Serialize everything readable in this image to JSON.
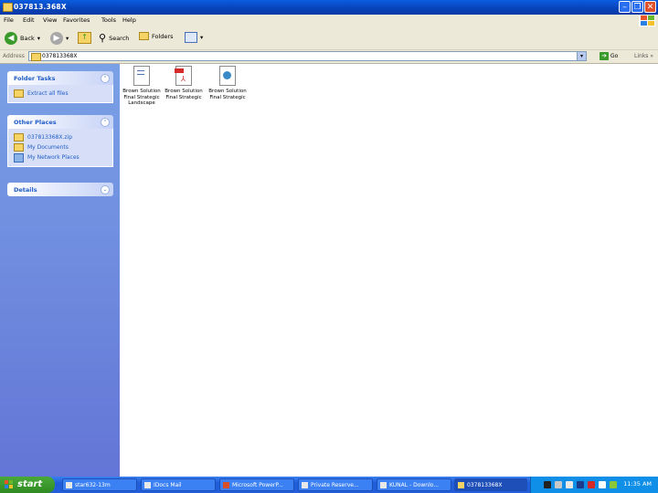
{
  "window": {
    "title": "037813.368X"
  },
  "menu": [
    "File",
    "Edit",
    "View",
    "Favorites",
    "Tools",
    "Help"
  ],
  "toolbar": {
    "back": "Back",
    "search": "Search",
    "folders": "Folders"
  },
  "address": {
    "label": "Address",
    "value": "037813368X",
    "go": "Go",
    "links": "Links"
  },
  "tasks": {
    "folder_tasks": {
      "title": "Folder Tasks",
      "items": [
        "Extract all files"
      ]
    },
    "other_places": {
      "title": "Other Places",
      "items": [
        "037813368X.zip",
        "My Documents",
        "My Network Places"
      ]
    },
    "details": {
      "title": "Details"
    }
  },
  "files": [
    {
      "name": "Brown Solution\nFinal Strategic\nLandscape",
      "type": "doc"
    },
    {
      "name": "Brown Solution\nFinal Strategic",
      "type": "pdf"
    },
    {
      "name": "Brown Solution\nFinal Strategic",
      "type": "web"
    }
  ],
  "taskbar": {
    "start": "start",
    "tasks": [
      "star632-13m",
      "IDocs Mail",
      "Microsoft PowerP...",
      "Private Reserve...",
      "KUNAL - Downlo...",
      "037813368X"
    ],
    "clock": "11:35 AM"
  }
}
